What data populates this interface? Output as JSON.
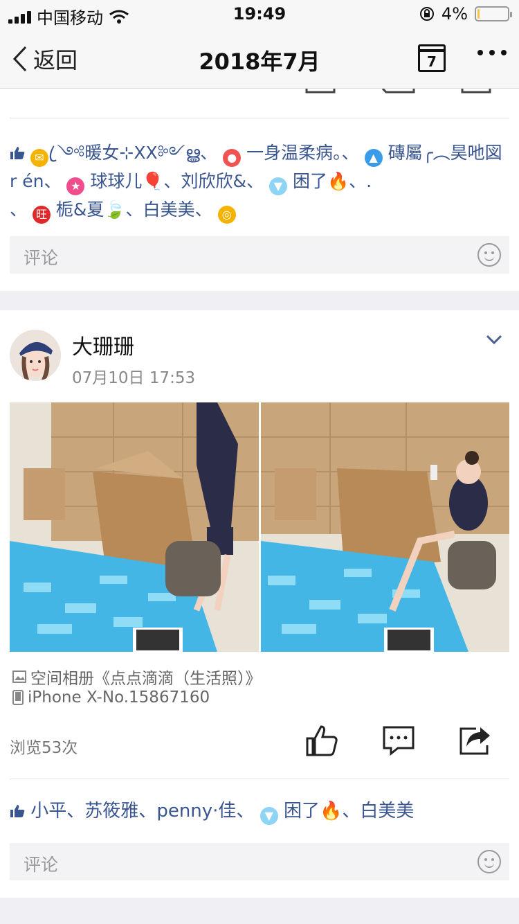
{
  "status_bar": {
    "carrier": "中国移动",
    "time": "19:49",
    "battery": "4%",
    "battery_level": 0.04
  },
  "nav": {
    "back_label": "返回",
    "title": "2018年7月",
    "calendar_day": "7"
  },
  "post1": {
    "likes": [
      "ꦿ༺暖女⊹XX༻ൠ",
      "一身温柔病。",
      "磚屬╭︵昊吔図 r én",
      "球球儿🎈",
      "刘欣欣&",
      "困了🔥",
      ".",
      "栀&夏🍃",
      "白美美"
    ],
    "comment_placeholder": "评论"
  },
  "post2": {
    "author": "大珊珊",
    "timestamp": "07月10日 17:53",
    "album": "空间相册《点点滴滴（生活照）》",
    "device": "iPhone X-No.15867160",
    "views": "浏览53次",
    "likes": [
      "小平",
      "苏筱雅",
      "penny·佳",
      "困了🔥",
      "白美美"
    ],
    "comment_placeholder": "评论"
  },
  "colors": {
    "link": "#3a5690",
    "bg_gap": "#efeff4",
    "battery": "#f4c542"
  }
}
